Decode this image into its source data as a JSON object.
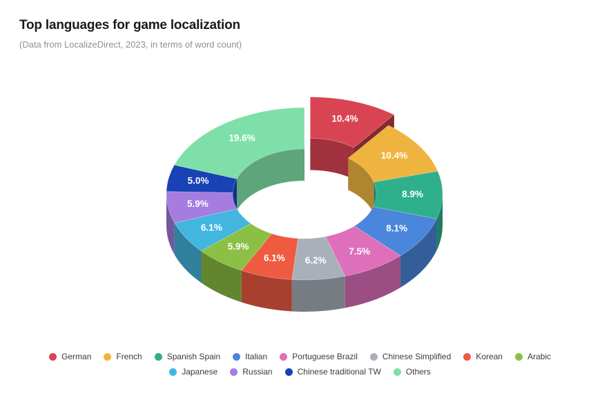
{
  "header": {
    "title": "Top languages for game localization",
    "subtitle": "(Data from LocalizeDirect, 2023, in terms of word count)"
  },
  "chart_data": {
    "type": "pie",
    "variant": "donut-3d-exploded",
    "title": "Top languages for game localization",
    "subtitle": "(Data from LocalizeDirect, 2023, in terms of word count)",
    "value_unit": "percent",
    "value_suffix": "%",
    "legend_position": "bottom",
    "grid": false,
    "exploded_slices": [
      "German"
    ],
    "start_angle_deg": 0,
    "direction": "clockwise",
    "inner_radius_ratio": 0.52,
    "categories": [
      "German",
      "French",
      "Spanish Spain",
      "Italian",
      "Portuguese Brazil",
      "Chinese Simplified",
      "Korean",
      "Arabic",
      "Japanese",
      "Russian",
      "Chinese traditional TW",
      "Others"
    ],
    "values": [
      10.4,
      10.4,
      8.9,
      8.1,
      7.5,
      6.2,
      6.1,
      5.9,
      6.1,
      5.9,
      5.0,
      19.6
    ],
    "labels": [
      "10.4%",
      "10.4%",
      "8.9%",
      "8.1%",
      "7.5%",
      "6.2%",
      "6.1%",
      "5.9%",
      "6.1%",
      "5.9%",
      "5.0%",
      "19.6%"
    ],
    "colors": [
      "#d94452",
      "#efb43f",
      "#2eb08c",
      "#4a86db",
      "#de6fbb",
      "#aab0ba",
      "#ee5b41",
      "#8cc044",
      "#43b6e0",
      "#a57ce0",
      "#1842b5",
      "#7fdfa8"
    ]
  },
  "legend": {
    "rows": [
      [
        {
          "label": "German",
          "color": "#d94452"
        },
        {
          "label": "French",
          "color": "#efb43f"
        },
        {
          "label": "Spanish Spain",
          "color": "#2eb08c"
        },
        {
          "label": "Italian",
          "color": "#4a86db"
        },
        {
          "label": "Portuguese Brazil",
          "color": "#de6fbb"
        },
        {
          "label": "Chinese Simplified",
          "color": "#aab0ba"
        },
        {
          "label": "Korean",
          "color": "#ee5b41"
        },
        {
          "label": "Arabic",
          "color": "#8cc044"
        }
      ],
      [
        {
          "label": "Japanese",
          "color": "#43b6e0"
        },
        {
          "label": "Russian",
          "color": "#a57ce0"
        },
        {
          "label": "Chinese traditional TW",
          "color": "#1842b5"
        },
        {
          "label": "Others",
          "color": "#7fdfa8"
        }
      ]
    ]
  }
}
